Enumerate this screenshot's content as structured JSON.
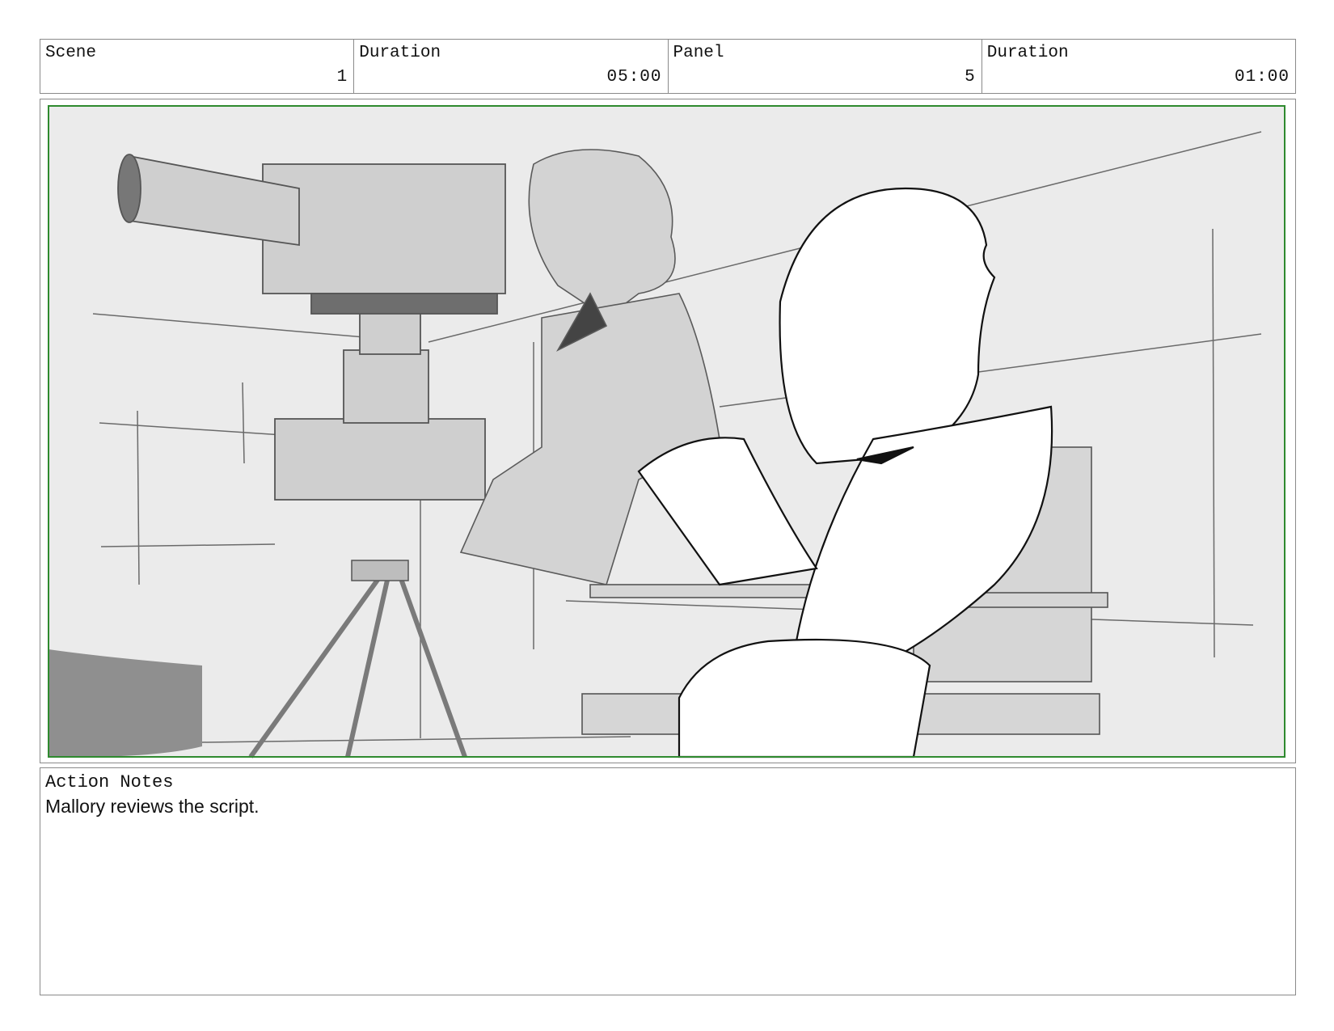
{
  "header": {
    "scene_label": "Scene",
    "scene_value": "1",
    "scene_duration_label": "Duration",
    "scene_duration_value": "05:00",
    "panel_label": "Panel",
    "panel_value": "5",
    "panel_duration_label": "Duration",
    "panel_duration_value": "01:00"
  },
  "notes": {
    "title": "Action Notes",
    "text": "Mallory reviews the script."
  },
  "colors": {
    "frame_border": "#2f8a2f",
    "sketch_bg": "#ebebeb",
    "line": "#555555"
  }
}
